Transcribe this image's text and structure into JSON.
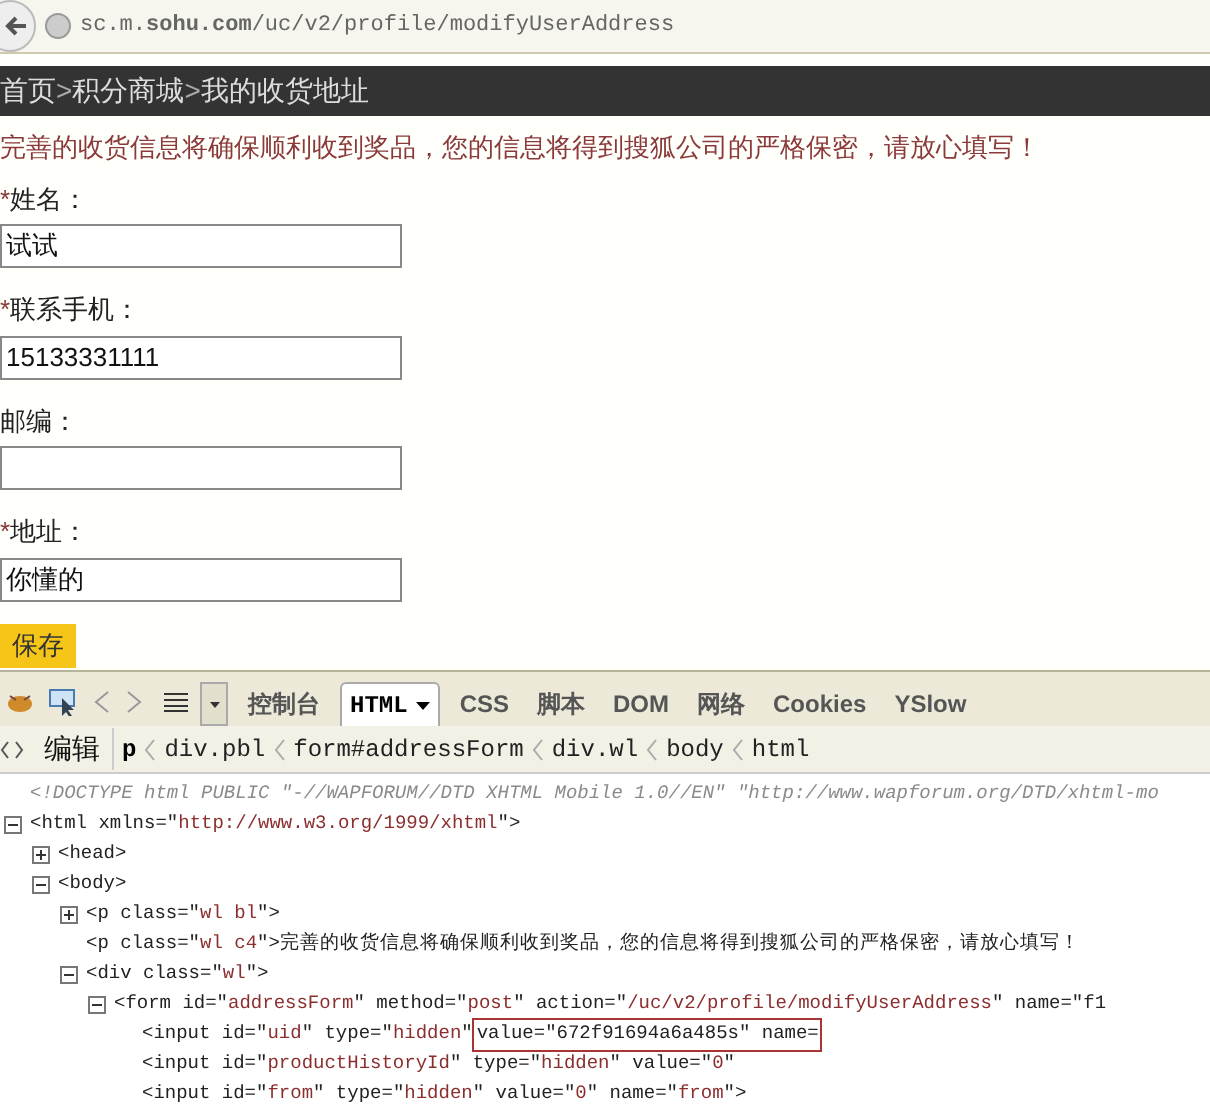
{
  "browser": {
    "url": "sc.m.**sohu.com**/uc/v2/profile/modifyUserAddress"
  },
  "breadcrumb": {
    "items": [
      "首页",
      "积分商城",
      "我的收货地址"
    ],
    "separator": ">"
  },
  "notice": "完善的收货信息将确保顺利收到奖品，您的信息将得到搜狐公司的严格保密，请放心填写！",
  "fields": [
    {
      "label": "姓名：",
      "required_mark": "*",
      "value": "试试"
    },
    {
      "label": "联系手机：",
      "required_mark": "*",
      "value": "15133331111"
    },
    {
      "label": "邮编："
    },
    {
      "label": "地址：",
      "required_mark": "*",
      "value": "你懂的"
    }
  ],
  "save_button": "保存",
  "devtools": {
    "tabs": [
      {
        "label": "控制台",
        "selected": false
      },
      {
        "label": "HTML",
        "selected": true
      },
      {
        "label": "CSS",
        "selected": false
      },
      {
        "label": "脚本",
        "selected": false
      },
      {
        "label": "DOM",
        "selected": false
      },
      {
        "label": "网络",
        "selected": false
      },
      {
        "label": "Cookies",
        "selected": false
      },
      {
        "label": "YSlow",
        "selected": false
      }
    ],
    "edit_button": "编辑",
    "path": [
      {
        "label": "p",
        "selected": true
      },
      {
        "label": "div.pbl",
        "selected": false
      },
      {
        "label": "form#addressForm",
        "selected": false
      },
      {
        "label": "div.wl",
        "selected": false
      },
      {
        "label": "body",
        "selected": false
      },
      {
        "label": "html",
        "selected": false
      }
    ],
    "tree": [
      {
        "tokens": [
          {
            "kind": "doctype",
            "text": "<!DOCTYPE html PUBLIC \"-//WAPFORUM//DTD XHTML Mobile 1.0//EN\" \"http://www.wapforum.org/DTD/xhtml-mo"
          }
        ]
      },
      {
        "expanded": true,
        "tokens": [
          {
            "kind": "tag",
            "text": "<html xmlns=\""
          },
          {
            "kind": "value",
            "text": "http://www.w3.org/1999/xhtml"
          },
          {
            "kind": "tag",
            "text": "\">"
          }
        ],
        "children": [
          {
            "expanded": false,
            "tokens": [
              {
                "kind": "tag",
                "text": "<head>"
              }
            ]
          },
          {
            "expanded": true,
            "tokens": [
              {
                "kind": "tag",
                "text": "<body>"
              }
            ],
            "children": [
              {
                "expanded": false,
                "tokens": [
                  {
                    "kind": "tag",
                    "text": "<p class=\""
                  },
                  {
                    "kind": "value",
                    "text": "wl bl"
                  },
                  {
                    "kind": "tag",
                    "text": "\">"
                  }
                ]
              },
              {
                "tokens": [
                  {
                    "kind": "tag",
                    "text": "<p class=\""
                  },
                  {
                    "kind": "value",
                    "text": "wl c4"
                  },
                  {
                    "kind": "tag",
                    "text": "\">"
                  },
                  {
                    "kind": "text",
                    "text": "完善的收货信息将确保顺利收到奖品，您的信息将得到搜狐公司的严格保密，请放心填写！"
                  }
                ]
              },
              {
                "expanded": true,
                "tokens": [
                  {
                    "kind": "tag",
                    "text": "<div class=\""
                  },
                  {
                    "kind": "value",
                    "text": "wl"
                  },
                  {
                    "kind": "tag",
                    "text": "\">"
                  }
                ],
                "children": [
                  {
                    "expanded": true,
                    "tokens": [
                      {
                        "kind": "tag",
                        "text": "<form id=\""
                      },
                      {
                        "kind": "value",
                        "text": "addressForm"
                      },
                      {
                        "kind": "tag",
                        "text": "\" method=\""
                      },
                      {
                        "kind": "value",
                        "text": "post"
                      },
                      {
                        "kind": "tag",
                        "text": "\" action=\""
                      },
                      {
                        "kind": "value",
                        "text": "/uc/v2/profile/modifyUserAddress"
                      },
                      {
                        "kind": "tag",
                        "text": "\" name=\"f1"
                      }
                    ],
                    "children": [
                      {
                        "tokens": [
                          {
                            "kind": "tag",
                            "text": "<input id=\""
                          },
                          {
                            "kind": "value",
                            "text": "uid"
                          },
                          {
                            "kind": "tag",
                            "text": "\" type=\""
                          },
                          {
                            "kind": "value",
                            "text": "hidden"
                          },
                          {
                            "kind": "tag",
                            "text": "\" "
                          },
                          {
                            "kind": "tag",
                            "text": "value=\"672f91694a6a485s\" name=",
                            "highlighted": true
                          }
                        ]
                      },
                      {
                        "tokens": [
                          {
                            "kind": "tag",
                            "text": "<input id=\""
                          },
                          {
                            "kind": "value",
                            "text": "productHistoryId"
                          },
                          {
                            "kind": "tag",
                            "text": "\" type=\""
                          },
                          {
                            "kind": "value",
                            "text": "hidden"
                          },
                          {
                            "kind": "tag",
                            "text": "\" value=\""
                          },
                          {
                            "kind": "value",
                            "text": "0"
                          },
                          {
                            "kind": "tag",
                            "text": "\""
                          }
                        ]
                      },
                      {
                        "tokens": [
                          {
                            "kind": "tag",
                            "text": "<input id=\""
                          },
                          {
                            "kind": "value",
                            "text": "from"
                          },
                          {
                            "kind": "tag",
                            "text": "\" type=\""
                          },
                          {
                            "kind": "value",
                            "text": "hidden"
                          },
                          {
                            "kind": "tag",
                            "text": "\" value=\""
                          },
                          {
                            "kind": "value",
                            "text": "0"
                          },
                          {
                            "kind": "tag",
                            "text": "\" name=\""
                          },
                          {
                            "kind": "value",
                            "text": "from"
                          },
                          {
                            "kind": "tag",
                            "text": "\">"
                          }
                        ]
                      }
                    ]
                  }
                ]
              }
            ]
          }
        ]
      }
    ]
  }
}
